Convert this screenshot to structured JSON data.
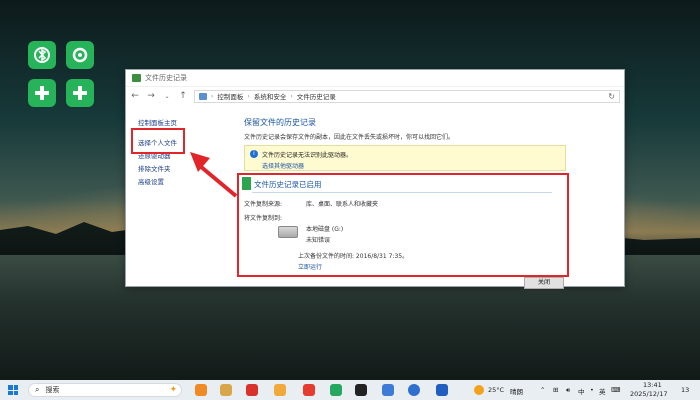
{
  "window": {
    "title": "文件历史记录",
    "breadcrumb": [
      "控制面板",
      "系统和安全",
      "文件历史记录"
    ]
  },
  "sidebar": {
    "items": [
      {
        "label": "控制面板主页"
      },
      {
        "label": "选择个人文件"
      },
      {
        "label": "还原驱动器"
      },
      {
        "label": "排除文件夹"
      },
      {
        "label": "高级设置"
      }
    ]
  },
  "main": {
    "heading": "保留文件的历史记录",
    "description": "文件历史记录会保存文件的副本，因此在文件丢失或损坏时，你可以找回它们。",
    "notice": {
      "text": "文件历史记录无法识别此驱动器。",
      "link": "选择其他驱动器"
    },
    "status": {
      "title": "文件历史记录已启用",
      "copy_from_label": "文件复制来源:",
      "copy_from_value": "库、桌面、联系人和收藏夹",
      "copy_to_label": "将文件复制到:",
      "drive_name": "本地磁盘 (G:)",
      "drive_status": "未知错误",
      "last_backup": "上次备份文件的时间: 2016/8/31 7:35。",
      "run_now": "立即运行"
    },
    "close_button": "关闭"
  },
  "taskbar": {
    "search_placeholder": "搜索",
    "weather_temp": "25°C",
    "weather_desc": "晴朗",
    "ime_lang": "中",
    "ime_mode": "英",
    "time": "13:41",
    "date": "2025/12/17",
    "notification_count": "13"
  },
  "colors": {
    "highlight": "#e0262b",
    "link": "#1a54a6",
    "desktop_icon": "#27b35a"
  }
}
